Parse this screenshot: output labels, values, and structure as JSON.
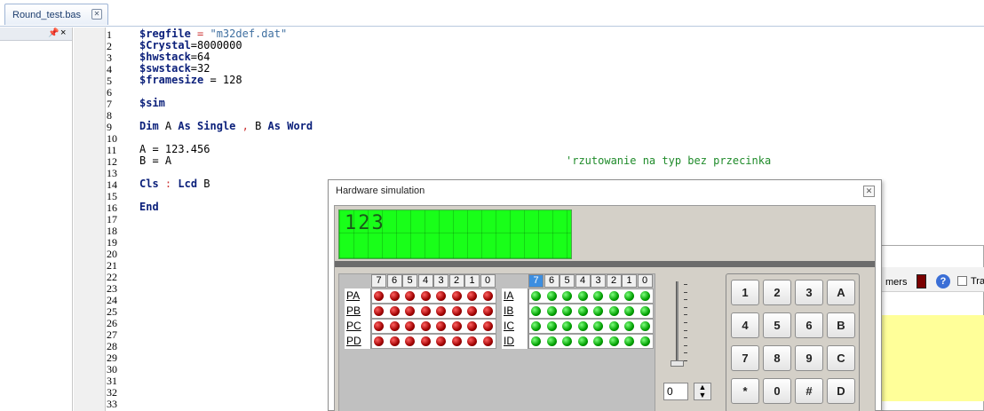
{
  "tab": {
    "label": "Round_test.bas"
  },
  "sidepanel": {
    "pin_icon": "pin-icon",
    "close_icon": "close-icon"
  },
  "editor": {
    "line_numbers": [
      "1",
      "2",
      "3",
      "4",
      "5",
      "6",
      "7",
      "8",
      "9",
      "10",
      "11",
      "12",
      "13",
      "14",
      "15",
      "16",
      "17",
      "18",
      "19",
      "20",
      "21",
      "22",
      "23",
      "24",
      "25",
      "26",
      "27",
      "28",
      "29",
      "30",
      "31",
      "32",
      "33"
    ],
    "lines": {
      "l1_kw": "$regfile",
      "l1_eq": " = ",
      "l1_str": "\"m32def.dat\"",
      "l2_kw": "$Crystal",
      "l2_rest": "=8000000",
      "l3_kw": "$hwstack",
      "l3_rest": "=64",
      "l4_kw": "$swstack",
      "l4_rest": "=32",
      "l5_kw": "$framesize",
      "l5_rest": " = 128",
      "l7_kw": "$sim",
      "l9_kw1": "Dim",
      "l9_a": " A ",
      "l9_kw2": "As Single",
      "l9_comma": " , ",
      "l9_b": "B ",
      "l9_kw3": "As Word",
      "l11": "A = 123.456",
      "l12": "B = A",
      "l12_comment": "'rzutowanie na typ bez przecinka",
      "l14_kw1": "Cls",
      "l14_colon": " : ",
      "l14_kw2": "Lcd",
      "l14_rest": " B",
      "l16_kw": "End"
    }
  },
  "bgwin": {
    "label": "mers",
    "checkbox_label": "Tra"
  },
  "sim": {
    "title": "Hardware simulation",
    "lcd_text": "123",
    "bits": [
      "7",
      "6",
      "5",
      "4",
      "3",
      "2",
      "1",
      "0"
    ],
    "out_ports": [
      "PA",
      "PB",
      "PC",
      "PD"
    ],
    "in_ports": [
      "IA",
      "IB",
      "IC",
      "ID"
    ],
    "spin_value": "0",
    "keys": [
      "1",
      "2",
      "3",
      "A",
      "4",
      "5",
      "6",
      "B",
      "7",
      "8",
      "9",
      "C",
      "*",
      "0",
      "#",
      "D"
    ]
  }
}
